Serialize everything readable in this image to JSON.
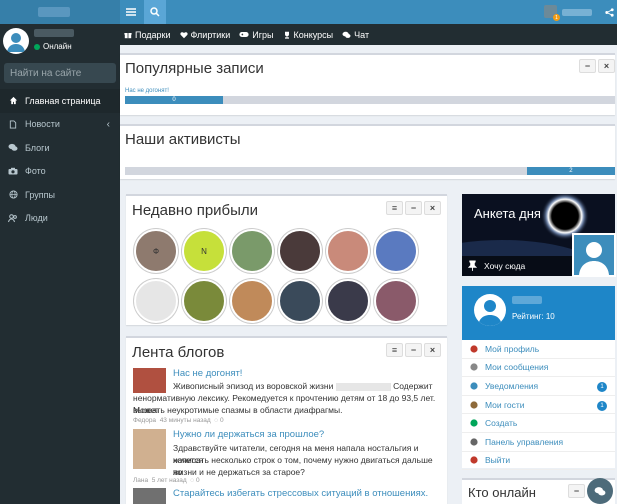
{
  "sidebar": {
    "user_status": "Онлайн",
    "search_placeholder": "Найти на сайте",
    "items": [
      {
        "label": "Главная страница",
        "icon": "home-icon",
        "active": true
      },
      {
        "label": "Новости",
        "icon": "file-icon",
        "chevron": "‹"
      },
      {
        "label": "Блоги",
        "icon": "comments-icon"
      },
      {
        "label": "Фото",
        "icon": "camera-icon"
      },
      {
        "label": "Группы",
        "icon": "globe-icon"
      },
      {
        "label": "Люди",
        "icon": "users-icon"
      }
    ]
  },
  "topbar": {
    "notification_count": "1"
  },
  "nav": {
    "items": [
      {
        "label": "Подарки",
        "icon": "gift-icon"
      },
      {
        "label": "Флиртики",
        "icon": "heart-icon"
      },
      {
        "label": "Игры",
        "icon": "gamepad-icon"
      },
      {
        "label": "Конкурсы",
        "icon": "trophy-icon"
      },
      {
        "label": "Чат",
        "icon": "chat-icon"
      }
    ]
  },
  "popular": {
    "title": "Популярные записи",
    "entry_label": "Нас не догонят!",
    "progress_value": "0",
    "progress_fraction": 0.2
  },
  "activists": {
    "title": "Наши активисты",
    "progress_value": "2",
    "progress_fraction": 0.18
  },
  "recent": {
    "title": "Недавно прибыли",
    "avatars": [
      {
        "letter": "Ф",
        "color": "#8e7a6e"
      },
      {
        "letter": "N",
        "color": "#c6e03a"
      },
      {
        "letter": "",
        "color": "#7a9a6a"
      },
      {
        "letter": "",
        "color": "#4a3a3a"
      },
      {
        "letter": "",
        "color": "#c98a7a"
      },
      {
        "letter": "",
        "color": "#5a7ac0"
      },
      {
        "letter": "",
        "color": "#e6e6e6"
      },
      {
        "letter": "",
        "color": "#7a8a3a"
      },
      {
        "letter": "",
        "color": "#c08a5a"
      },
      {
        "letter": "",
        "color": "#3a4a5a"
      },
      {
        "letter": "",
        "color": "#3a3a4a"
      },
      {
        "letter": "",
        "color": "#8a5a6a"
      }
    ]
  },
  "feed": {
    "title": "Лента блогов",
    "entries": [
      {
        "title": "Нас не догонят!",
        "text_1": "Живописный эпизод из воровской жизни",
        "text_1b": "Содержит",
        "text_2": "ненормативную лексику. Рекомедуется к прочтению детям от 18 до 93,5 лет. Может",
        "text_3": "вызвать неукротимые спазмы в области диафрагмы.",
        "author": "Федора",
        "time": "43 минуты назад",
        "comments": "0",
        "thumb_color": "#b05040"
      },
      {
        "title": "Нужно ли держаться за прошлое?",
        "text_1": "Здравствуйте читатели, сегодня на меня напала ностальгия и хочется",
        "text_2": "написать несколько строк о том, почему нужно двигаться дальше по",
        "text_3": "жизни и не держаться за старое?",
        "author": "Лана",
        "time": "5 лет назад",
        "comments": "0",
        "thumb_color": "#d0b090"
      },
      {
        "title": "Старайтесь избегать стрессовых ситуаций в отношениях.",
        "thumb_color": "#707070"
      }
    ]
  },
  "anketa": {
    "title": "Анкета дня",
    "want_label": "Хочу сюда"
  },
  "profile": {
    "rating": "Рейтинг: 10",
    "items": [
      {
        "label": "Мой профиль",
        "icon": "user-icon",
        "color": "#c0392b"
      },
      {
        "label": "Мои сообщения",
        "icon": "mail-icon",
        "color": "#888888"
      },
      {
        "label": "Уведомления",
        "icon": "info-icon",
        "color": "#3c8dbc",
        "count": "1"
      },
      {
        "label": "Мои гости",
        "icon": "guests-icon",
        "color": "#8e6a3a",
        "count": "1"
      },
      {
        "label": "Создать",
        "icon": "plus-icon",
        "color": "#00a65a"
      },
      {
        "label": "Панель управления",
        "icon": "settings-icon",
        "color": "#666666"
      },
      {
        "label": "Выйти",
        "icon": "exit-icon",
        "color": "#c0392b"
      }
    ]
  },
  "online": {
    "title": "Кто онлайн"
  },
  "colors": {
    "topbar": "#3c8dbc",
    "sidebar": "#222d32",
    "accent": "#1e86c8"
  }
}
